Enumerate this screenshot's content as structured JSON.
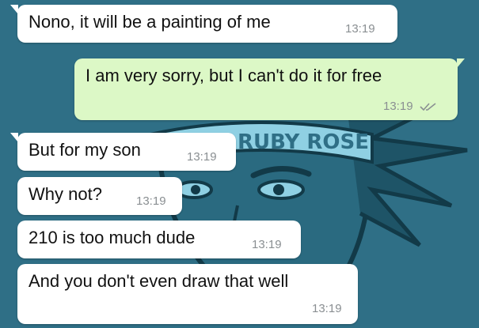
{
  "wallpaper": {
    "banner_text": "RUBY ROSE",
    "colors": {
      "background": "#2f6f86",
      "line": "#123a48",
      "banner": "#8fd0e3"
    }
  },
  "messages": [
    {
      "direction": "incoming",
      "text": "Nono, it will be a painting of me",
      "time": "13:19"
    },
    {
      "direction": "outgoing",
      "text": "I am very sorry, but I can't do it for free",
      "time": "13:19",
      "status_icon": "double-check-icon"
    },
    {
      "direction": "incoming",
      "text": "But for my son",
      "time": "13:19"
    },
    {
      "direction": "incoming",
      "text": "Why not?",
      "time": "13:19"
    },
    {
      "direction": "incoming",
      "text": "210 is too much dude",
      "time": "13:19"
    },
    {
      "direction": "incoming",
      "text": "And you don't even draw that well",
      "time": "13:19"
    }
  ]
}
